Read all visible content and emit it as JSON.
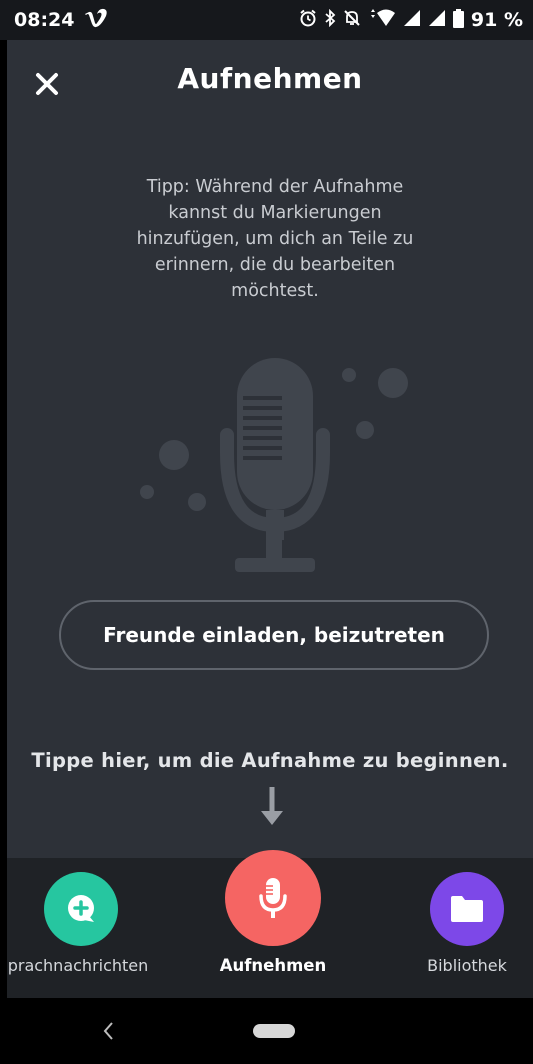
{
  "status_bar": {
    "time": "08:24",
    "battery": "91 %"
  },
  "header": {
    "title": "Aufnehmen"
  },
  "tip": {
    "text": "Tipp: Während der Aufnahme kannst du Markierungen hinzufügen, um dich an Teile zu erinnern, die du bearbeiten möchtest."
  },
  "invite_button": {
    "label": "Freunde einladen, beizutreten"
  },
  "hint": {
    "text": "Tippe hier, um die Aufnahme zu beginnen."
  },
  "tabs": [
    {
      "label": "prachnachrichten",
      "icon": "chat-plus-icon",
      "color": "#26c6a0"
    },
    {
      "label": "Aufnehmen",
      "icon": "microphone-icon",
      "color": "#f56563",
      "active": true
    },
    {
      "label": "Bibliothek",
      "icon": "folder-icon",
      "color": "#7d48e8"
    }
  ],
  "colors": {
    "background": "#2d3138",
    "tabbar": "#1f2226",
    "illustration": "#40454d"
  }
}
